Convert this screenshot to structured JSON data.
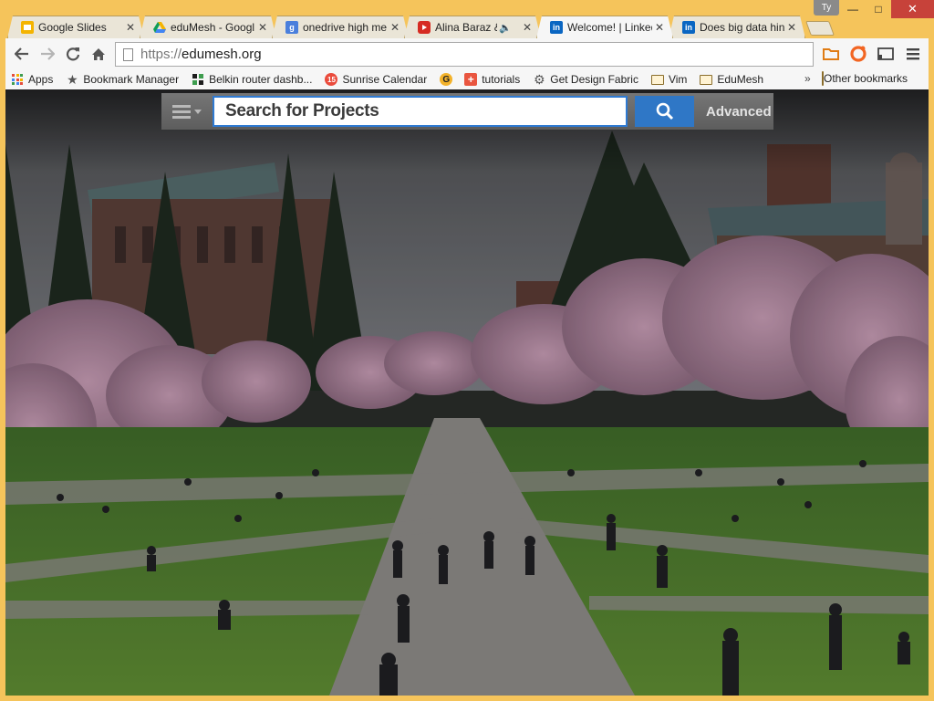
{
  "window": {
    "profile_initials": "Ty",
    "frame_color": "#f5c45b"
  },
  "tabs": [
    {
      "title": "Google Slides",
      "favicon": "google-slides-icon",
      "color": "#f4b400",
      "active": false
    },
    {
      "title": "eduMesh - Googl",
      "favicon": "google-drive-icon",
      "color": "#3e9d4f",
      "active": false
    },
    {
      "title": "onedrive high me",
      "favicon": "google-search-icon",
      "color": "#4a7fdc",
      "active": false
    },
    {
      "title": "Alina Baraz & G",
      "favicon": "youtube-icon",
      "color": "#d62b22",
      "active": false,
      "audio": true
    },
    {
      "title": "Welcome! | Linked",
      "favicon": "linkedin-icon",
      "color": "#0a66c2",
      "active": true
    },
    {
      "title": "Does big data hin",
      "favicon": "linkedin-icon",
      "color": "#0a66c2",
      "active": false
    }
  ],
  "toolbar": {
    "url_protocol": "https://",
    "url_host": "edumesh.org"
  },
  "bookmarks": [
    {
      "label": "Apps",
      "icon": "apps-grid-icon"
    },
    {
      "label": "Bookmark Manager",
      "icon": "star-icon"
    },
    {
      "label": "Belkin router dashb...",
      "icon": "belkin-icon"
    },
    {
      "label": "Sunrise Calendar",
      "icon": "sunrise-calendar-icon",
      "badge": "15"
    },
    {
      "label": "",
      "icon": "g-circle-icon"
    },
    {
      "label": "tutorials",
      "icon": "plus-square-icon"
    },
    {
      "label": "Get Design Fabric",
      "icon": "gear-icon"
    },
    {
      "label": "Vim",
      "icon": "folder-icon"
    },
    {
      "label": "EduMesh",
      "icon": "folder-icon"
    }
  ],
  "bookmarks_more": "»",
  "other_bookmarks": "Other bookmarks",
  "page": {
    "search_placeholder": "Search for Projects",
    "advanced_label": "Advanced"
  }
}
